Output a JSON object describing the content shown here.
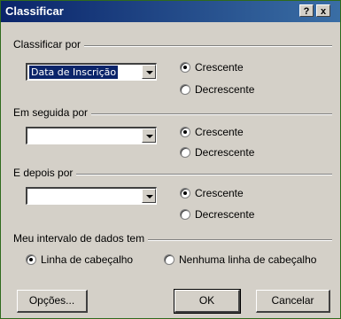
{
  "window": {
    "title": "Classificar",
    "help_button": "?",
    "close_button": "x"
  },
  "sort_by": {
    "label": "Classificar por",
    "value": "Data de Inscrição",
    "asc": "Crescente",
    "desc": "Decrescente",
    "selected": "asc"
  },
  "then_by": {
    "label": "Em seguida por",
    "value": "",
    "asc": "Crescente",
    "desc": "Decrescente",
    "selected": "asc"
  },
  "then_by2": {
    "label": "E depois por",
    "value": "",
    "asc": "Crescente",
    "desc": "Decrescente",
    "selected": "asc"
  },
  "range": {
    "label": "Meu intervalo de dados tem",
    "header_row": "Linha de cabeçalho",
    "no_header_row": "Nenhuma linha de cabeçalho",
    "selected": "header_row"
  },
  "buttons": {
    "options": "Opções...",
    "ok": "OK",
    "cancel": "Cancelar"
  }
}
